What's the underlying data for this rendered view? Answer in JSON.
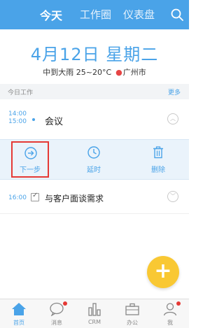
{
  "header": {
    "tabs": [
      {
        "label": "今天",
        "active": true
      },
      {
        "label": "工作圈",
        "active": false
      },
      {
        "label": "仪表盘",
        "active": false
      }
    ],
    "search_icon": "search-icon",
    "color": "#4aa3e8"
  },
  "date_display": {
    "date": "4月12日 星期二",
    "weather": "中到大雨 25~20°C",
    "location": "广州市"
  },
  "section": {
    "label": "今日工作",
    "more": "更多"
  },
  "tasks": [
    {
      "start": "14:00",
      "end": "15:00",
      "title": "会议",
      "expanded": true,
      "actions": [
        {
          "label": "下一步",
          "icon": "arrow-right-circle-icon",
          "highlighted": true
        },
        {
          "label": "延时",
          "icon": "clock-icon",
          "highlighted": false
        },
        {
          "label": "删除",
          "icon": "trash-icon",
          "highlighted": false
        }
      ]
    },
    {
      "start": "16:00",
      "title": "与客户面谈需求",
      "expanded": false
    }
  ],
  "fab": {
    "label": "+",
    "color": "#f9c833"
  },
  "bottom_nav": [
    {
      "label": "首页",
      "icon": "home-icon",
      "active": true
    },
    {
      "label": "消息",
      "icon": "chat-bubble-icon",
      "active": false,
      "badge": true
    },
    {
      "label": "CRM",
      "icon": "bar-chart-icon",
      "active": false
    },
    {
      "label": "办公",
      "icon": "briefcase-icon",
      "active": false
    },
    {
      "label": "我",
      "icon": "person-icon",
      "active": false,
      "badge": true
    }
  ]
}
